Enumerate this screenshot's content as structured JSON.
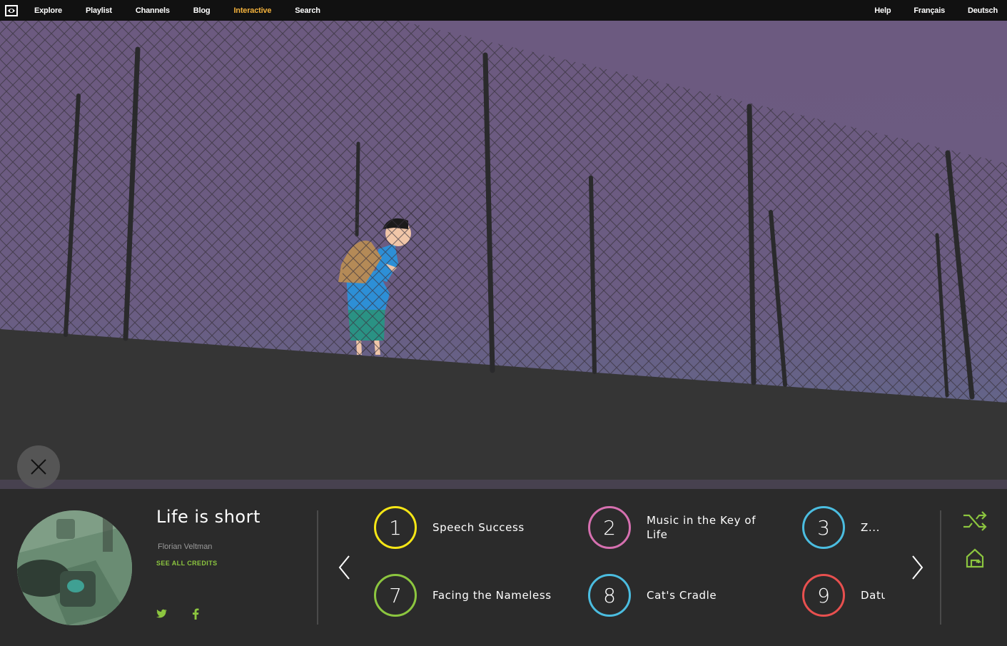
{
  "nav": {
    "left": [
      "Explore",
      "Playlist",
      "Channels",
      "Blog",
      "Interactive",
      "Search"
    ],
    "right": [
      "Help",
      "Français",
      "Deutsch"
    ],
    "active": "Interactive",
    "active_color": "#f2b13c"
  },
  "film": {
    "title": "Life is short",
    "author": "Florian Veltman",
    "credits_label": "SEE ALL CREDITS"
  },
  "chapters": [
    {
      "number": "1",
      "label": "Speech Success",
      "color": "#f5e616"
    },
    {
      "number": "2",
      "label": "Music in the Key of Life",
      "color": "#d670b0"
    },
    {
      "number": "3",
      "label": "Z...",
      "color": "#4bbde0"
    },
    {
      "number": "7",
      "label": "Facing the Nameless",
      "color": "#8cc63f"
    },
    {
      "number": "8",
      "label": "Cat's Cradle",
      "color": "#4bbde0"
    },
    {
      "number": "9",
      "label": "Datu",
      "color": "#e8504f"
    }
  ],
  "colors": {
    "accent_green": "#8cc63f",
    "sky": "#6a5a80",
    "ground": "#353535",
    "panel": "#2b2b2b"
  },
  "icons": {
    "close": "close-icon",
    "prev": "chevron-left-icon",
    "next": "chevron-right-icon",
    "shuffle": "shuffle-icon",
    "home": "home-icon",
    "twitter": "twitter-icon",
    "facebook": "facebook-icon"
  }
}
